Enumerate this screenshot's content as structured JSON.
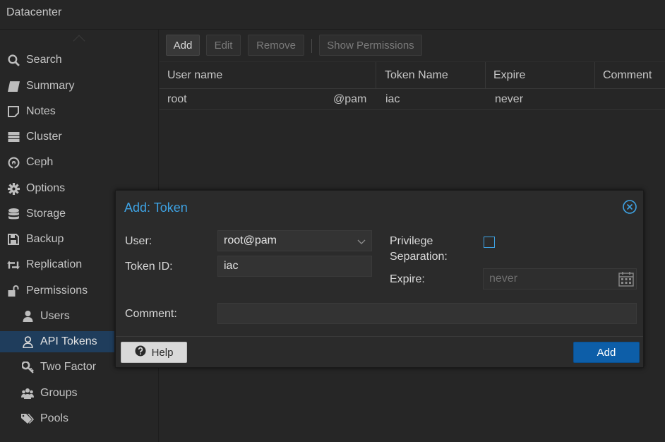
{
  "topbar": {
    "title": "Datacenter"
  },
  "sidebar": {
    "items": [
      {
        "label": "Search",
        "icon": "search-icon"
      },
      {
        "label": "Summary",
        "icon": "book-icon"
      },
      {
        "label": "Notes",
        "icon": "note-icon"
      },
      {
        "label": "Cluster",
        "icon": "server-icon"
      },
      {
        "label": "Ceph",
        "icon": "ceph-icon"
      },
      {
        "label": "Options",
        "icon": "gear-icon"
      },
      {
        "label": "Storage",
        "icon": "database-icon"
      },
      {
        "label": "Backup",
        "icon": "floppy-icon"
      },
      {
        "label": "Replication",
        "icon": "retweet-icon"
      },
      {
        "label": "Permissions",
        "icon": "unlock-icon"
      },
      {
        "label": "Users",
        "icon": "user-icon"
      },
      {
        "label": "API Tokens",
        "icon": "user-outline-icon"
      },
      {
        "label": "Two Factor",
        "icon": "key-icon"
      },
      {
        "label": "Groups",
        "icon": "users-icon"
      },
      {
        "label": "Pools",
        "icon": "tags-icon"
      }
    ]
  },
  "toolbar": {
    "add": "Add",
    "edit": "Edit",
    "remove": "Remove",
    "show_permissions": "Show Permissions"
  },
  "grid": {
    "columns": [
      "User name",
      "Token Name",
      "Expire",
      "Comment"
    ],
    "rows": [
      {
        "user": "root",
        "realm": "@pam",
        "token": "iac",
        "expire": "never",
        "comment": ""
      }
    ]
  },
  "dialog": {
    "title": "Add: Token",
    "user_label": "User:",
    "user_value": "root@pam",
    "token_id_label": "Token ID:",
    "token_id_value": "iac",
    "privsep_label_1": "Privilege",
    "privsep_label_2": "Separation:",
    "expire_label": "Expire:",
    "expire_placeholder": "never",
    "comment_label": "Comment:",
    "help": "Help",
    "add": "Add"
  },
  "colors": {
    "accent": "#3ea2e3",
    "primary_button": "#0d5ea8",
    "selected_nav": "#1f3d5c"
  }
}
